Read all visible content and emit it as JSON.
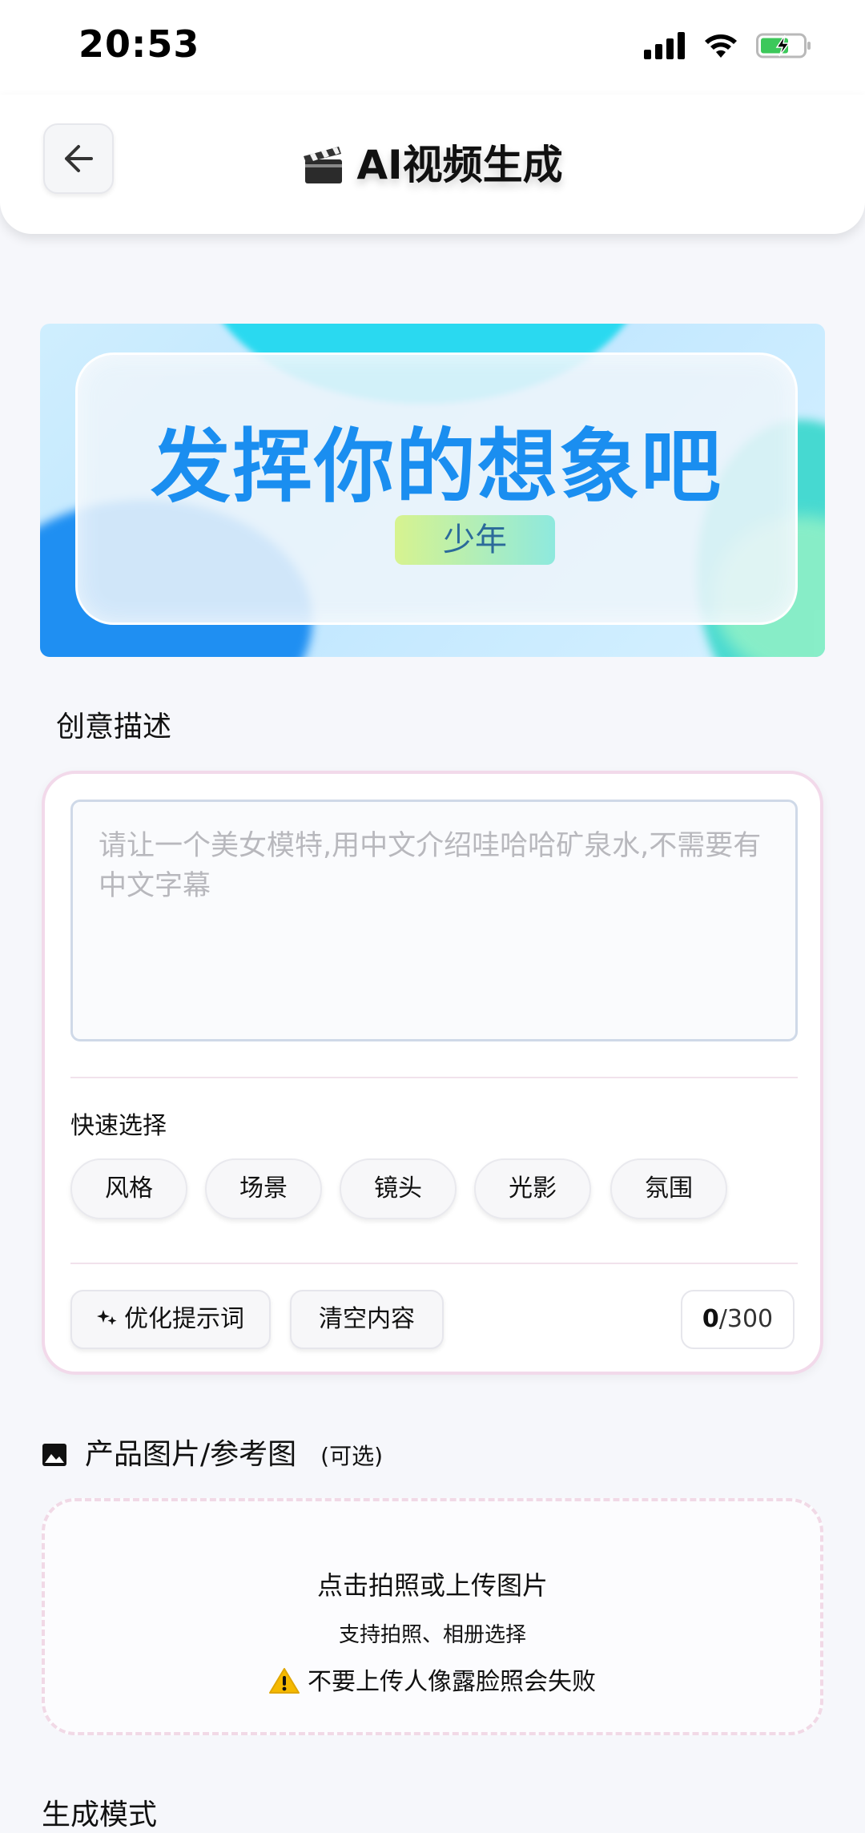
{
  "status_bar": {
    "time": "20:53"
  },
  "header": {
    "title": "AI视频生成"
  },
  "banner": {
    "headline": "发挥你的想象吧",
    "tag": "少年"
  },
  "creative": {
    "section_label": "创意描述",
    "placeholder": "请让一个美女模特,用中文介绍哇哈哈矿泉水,不需要有中文字幕",
    "quick_select_label": "快速选择",
    "chips": [
      "风格",
      "场景",
      "镜头",
      "光影",
      "氛围"
    ],
    "optimize_button": "优化提示词",
    "clear_button": "清空内容",
    "counter_current": "0",
    "counter_max": "/300"
  },
  "upload": {
    "section_label": "产品图片/参考图",
    "optional": "(可选)",
    "title": "点击拍照或上传图片",
    "subtitle": "支持拍照、相册选择",
    "warning": "不要上传人像露脸照会失败"
  },
  "mode": {
    "section_label": "生成模式"
  }
}
